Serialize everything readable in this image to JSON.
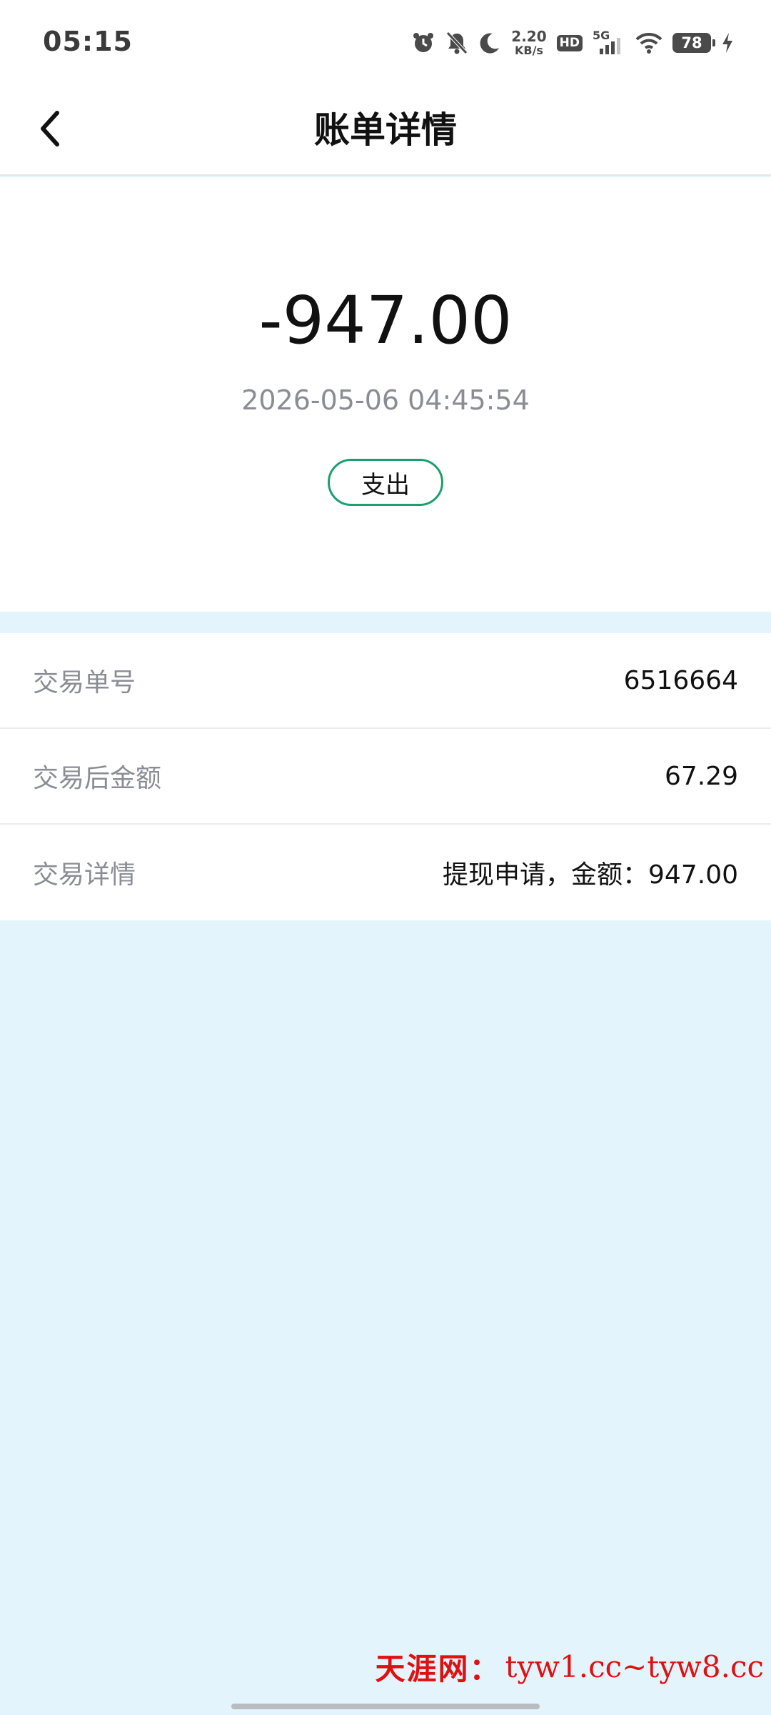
{
  "status_bar": {
    "time": "05:15",
    "net_speed_value": "2.20",
    "net_speed_unit": "KB/s",
    "hd_label": "HD",
    "network_type": "5G",
    "battery_level": "78",
    "icons": [
      "alarm-icon",
      "mute-bell-icon",
      "moon-icon",
      "signal-icon",
      "wifi-icon",
      "battery-icon",
      "charging-bolt-icon"
    ]
  },
  "header": {
    "title": "账单详情",
    "back_icon": "chevron-left-icon"
  },
  "summary": {
    "amount": "-947.00",
    "datetime": "2026-05-06 04:45:54",
    "type_label": "支出",
    "accent_color": "#1aa06d"
  },
  "details": {
    "rows": [
      {
        "label": "交易单号",
        "value": "6516664"
      },
      {
        "label": "交易后金额",
        "value": "67.29"
      },
      {
        "label": "交易详情",
        "value": "提现申请，金额：947.00"
      }
    ]
  },
  "watermark": {
    "site_name": "天涯网：",
    "urls": "tyw1.cc~tyw8.cc",
    "color": "#e01010"
  },
  "colors": {
    "background": "#e4f4fd",
    "card": "#ffffff",
    "muted_text": "#8a8d94"
  }
}
